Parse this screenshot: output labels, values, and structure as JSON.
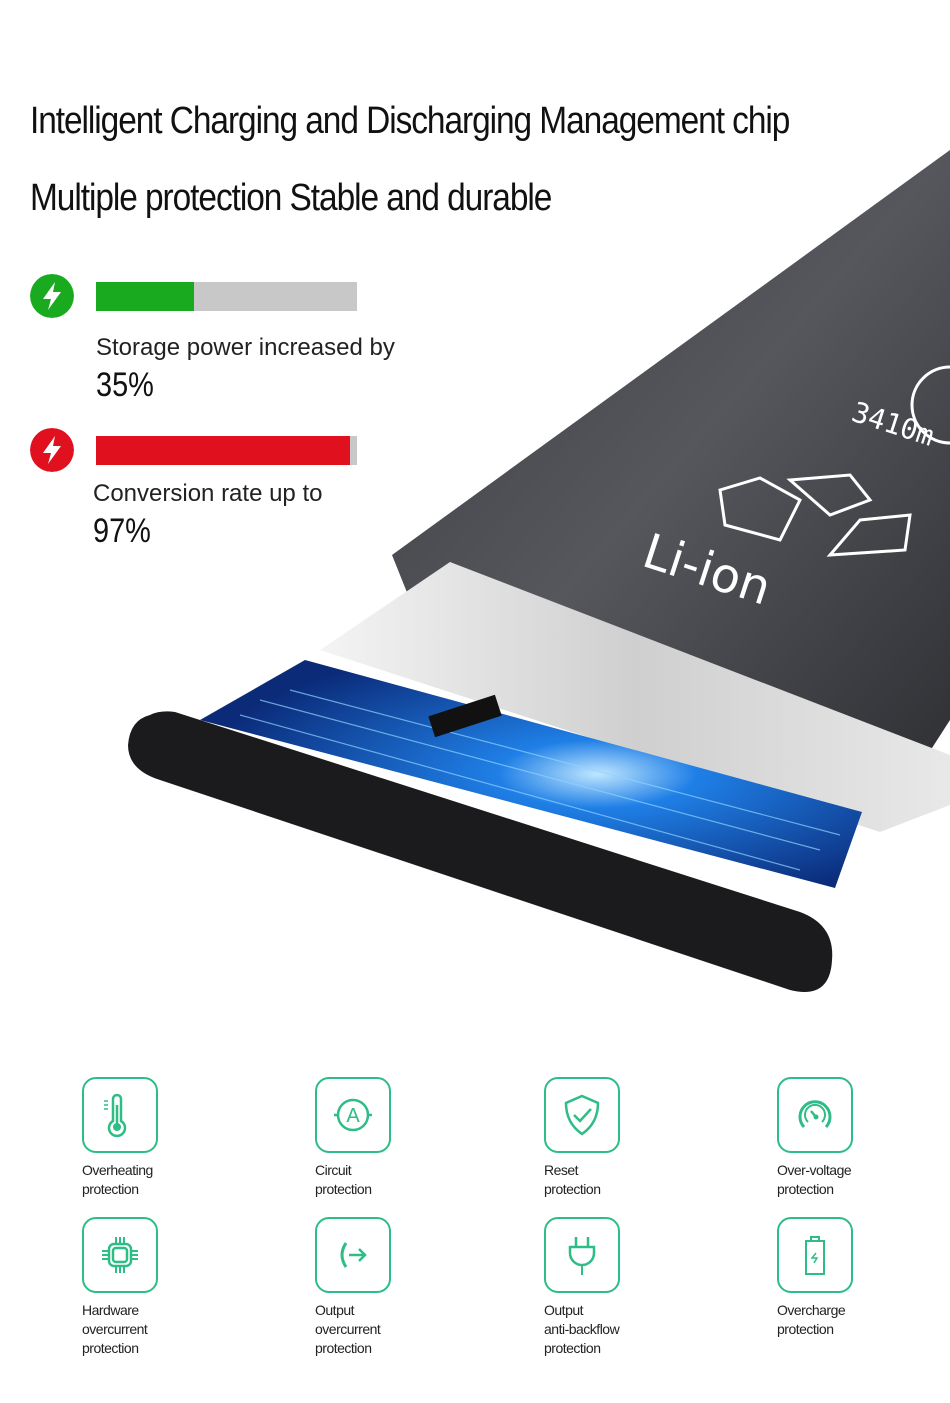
{
  "headline": {
    "line1": "Intelligent Charging and Discharging Management chip",
    "line2": "Multiple protection Stable and durable"
  },
  "stats": [
    {
      "icon": "lightning-bolt-icon",
      "color": "#1aaa1f",
      "label": "Storage power increased by",
      "value": "35%",
      "fill_fraction": 0.375
    },
    {
      "icon": "lightning-bolt-icon",
      "color": "#e0101e",
      "label": "Conversion rate up to",
      "value": "97%",
      "fill_fraction": 0.975
    }
  ],
  "battery": {
    "capacity_text": "3410m",
    "type_text": "Li-ion"
  },
  "accent_color": "#2ebd86",
  "features": [
    {
      "icon": "thermometer-icon",
      "lines": [
        "Overheating",
        "protection"
      ]
    },
    {
      "icon": "ammeter-icon",
      "lines": [
        "Circuit",
        "protection"
      ]
    },
    {
      "icon": "shield-check-icon",
      "lines": [
        "Reset",
        "protection"
      ]
    },
    {
      "icon": "gauge-icon",
      "lines": [
        "Over-voltage",
        "protection"
      ]
    },
    {
      "icon": "chip-icon",
      "lines": [
        "Hardware",
        "overcurrent",
        "protection"
      ]
    },
    {
      "icon": "output-arrow-icon",
      "lines": [
        "Output",
        "overcurrent",
        "protection"
      ]
    },
    {
      "icon": "plug-icon",
      "lines": [
        "Output",
        "anti-backflow",
        "protection"
      ]
    },
    {
      "icon": "battery-icon",
      "lines": [
        "Overcharge",
        "protection"
      ]
    }
  ]
}
